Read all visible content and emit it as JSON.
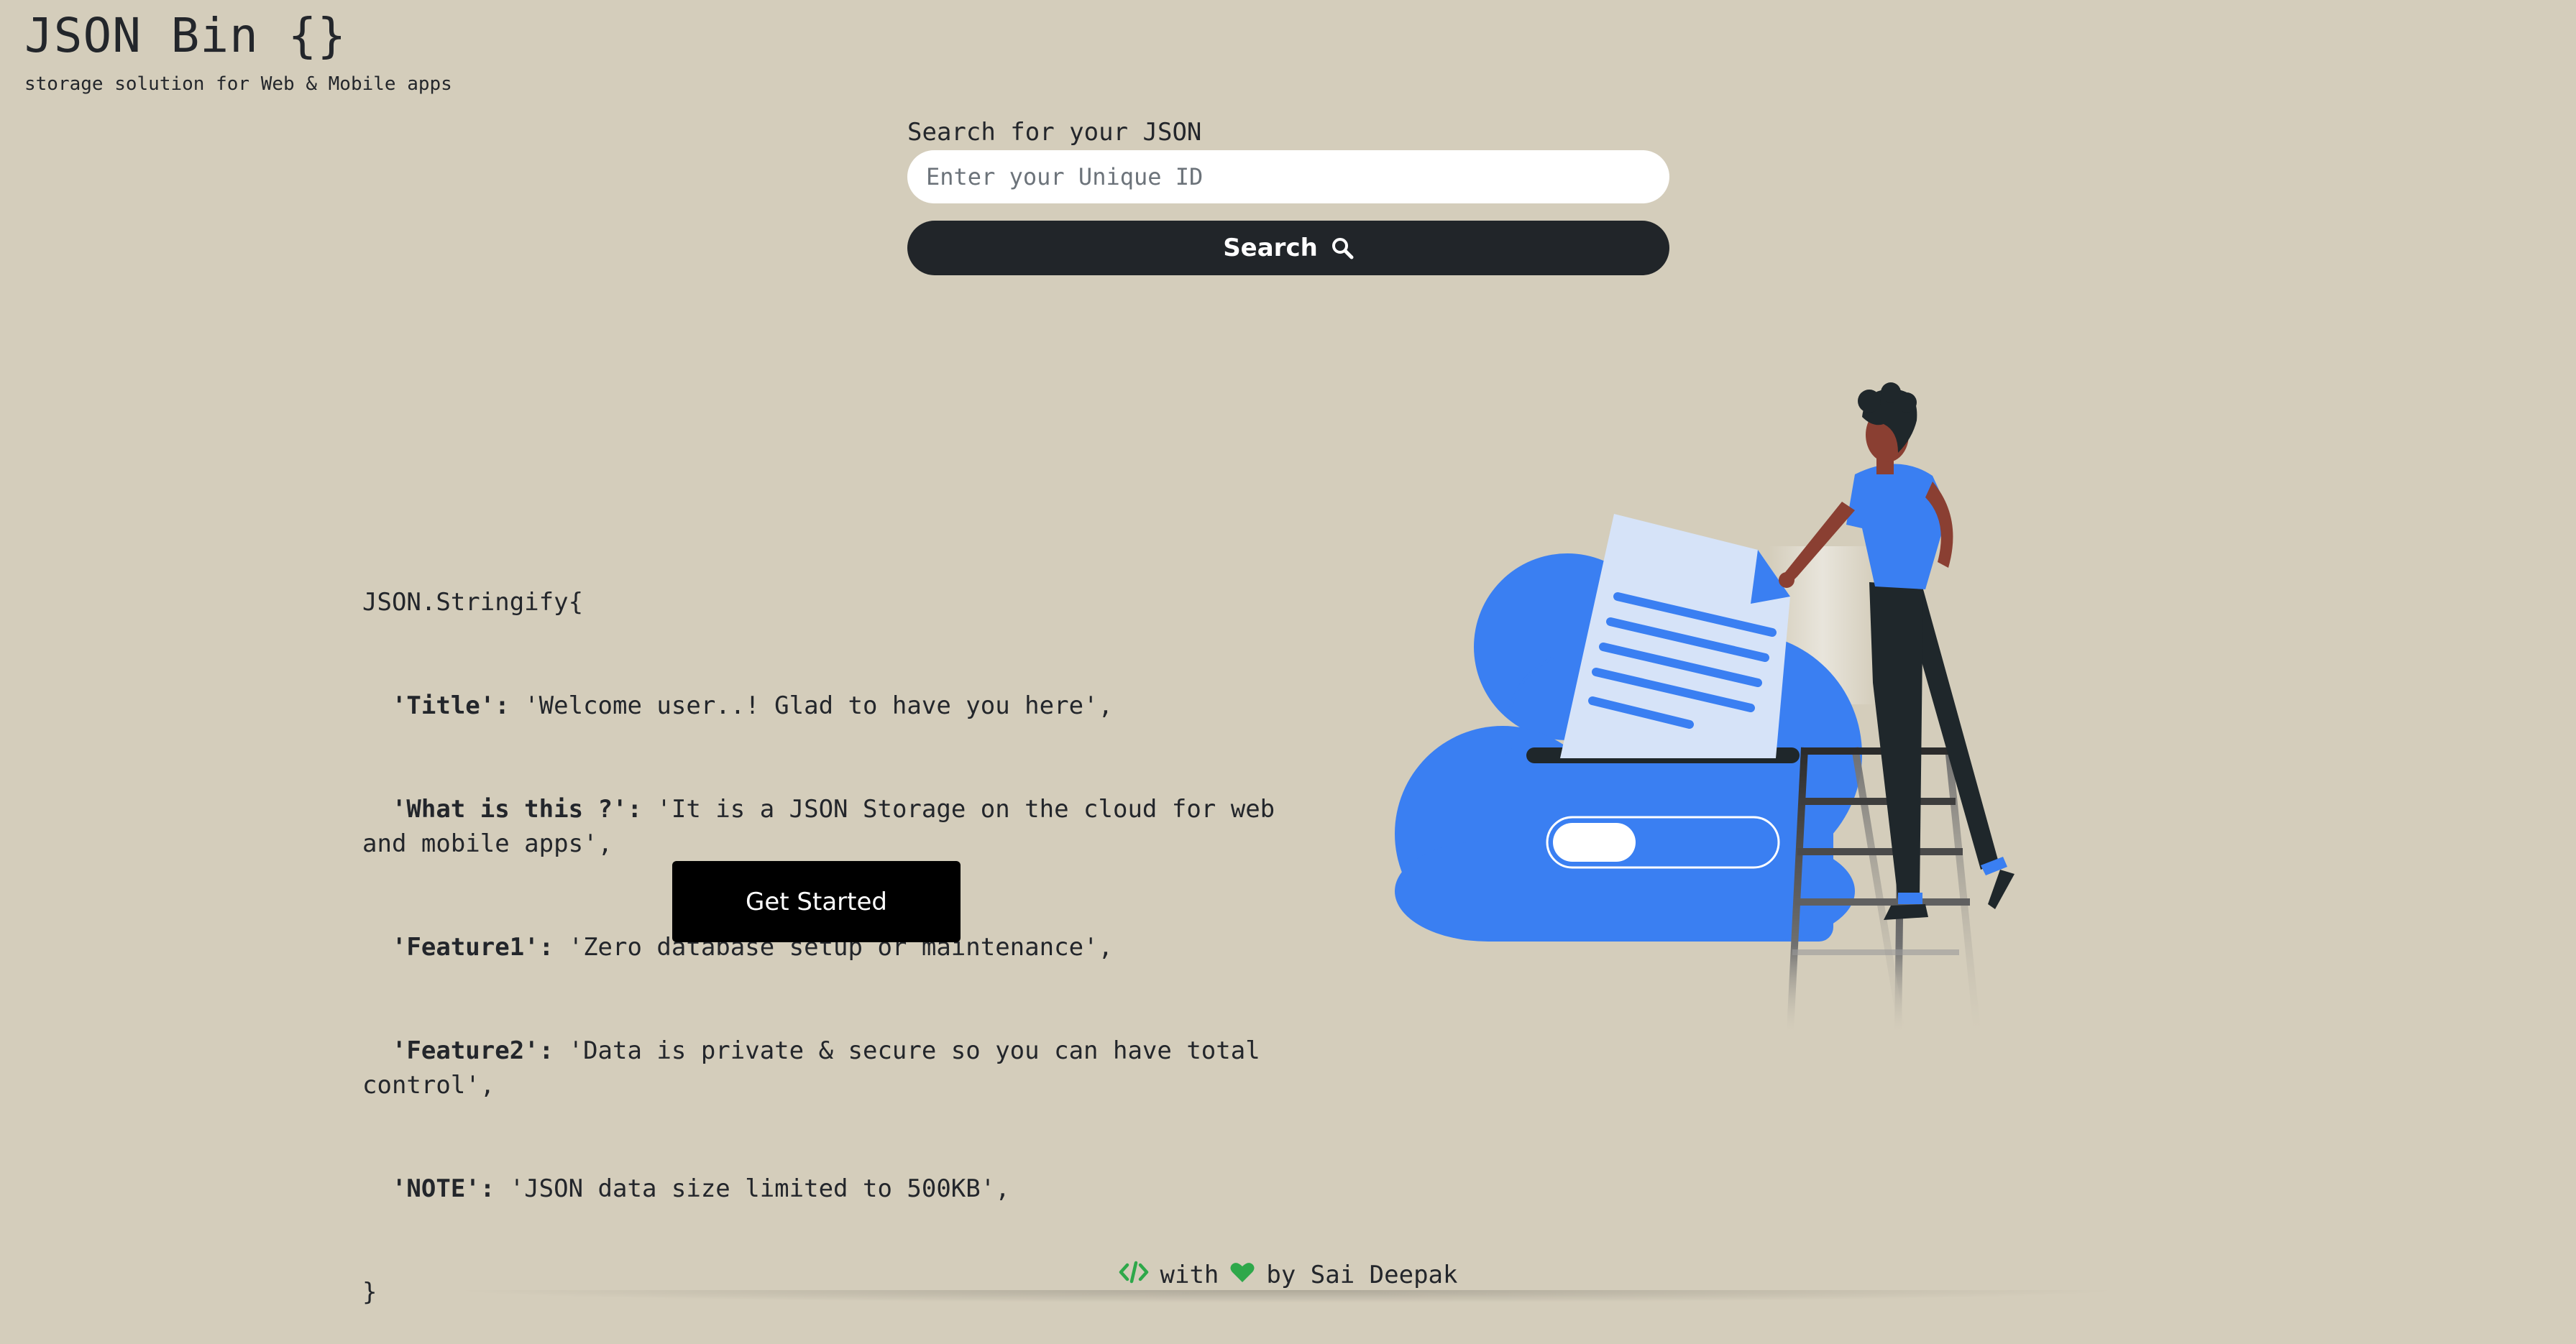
{
  "header": {
    "title": "JSON Bin {}",
    "subtitle": "storage solution for Web & Mobile apps"
  },
  "search": {
    "label": "Search for your JSON",
    "placeholder": "Enter your Unique ID",
    "value": "",
    "button_label": "Search",
    "button_icon": "search-icon"
  },
  "intro": {
    "open_line": "JSON.Stringify{",
    "entries": [
      {
        "key": "'Title':",
        "value": " 'Welcome user..! Glad to have you here',"
      },
      {
        "key": "'What is this ?':",
        "value": " 'It is a JSON Storage on the cloud for web and mobile apps',"
      },
      {
        "key": "'Feature1':",
        "value": " 'Zero database setup or maintenance',"
      },
      {
        "key": "'Feature2':",
        "value": " 'Data is private & secure so you can have total control',"
      },
      {
        "key": "'NOTE':",
        "value": " 'JSON data size limited to 500KB',"
      }
    ],
    "close_line": "}",
    "cta_label": "Get Started"
  },
  "illustration": {
    "icon": "cloud-upload-illustration",
    "colors": {
      "cloud": "#3a7ff2",
      "paper": "#d6e3f8",
      "lines": "#3a7ff2",
      "shirt": "#3a7ff2",
      "pants": "#1f272b",
      "skin": "#8a3f32",
      "ladder": "#2b2b2b"
    }
  },
  "footer": {
    "code_icon": "code-icon",
    "heart_icon": "heart-icon",
    "with_text": "with",
    "by_text": "by Sai Deepak",
    "accent_color": "#2ea84a"
  },
  "colors": {
    "background": "#d4cdbb",
    "dark": "#212529",
    "button_black": "#000000"
  }
}
